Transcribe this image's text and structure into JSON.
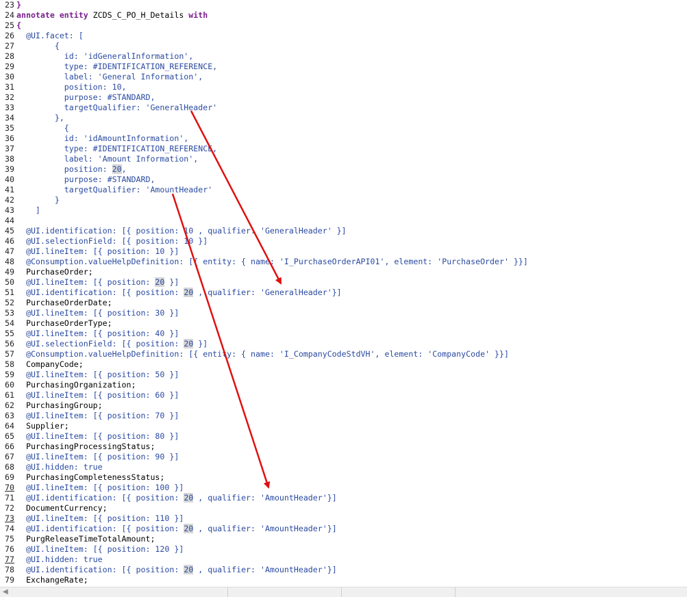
{
  "editor": {
    "lines": [
      {
        "n": "23",
        "t": "}"
      },
      {
        "n": "24",
        "t": "annotate entity ZCDS_C_PO_H_Details with"
      },
      {
        "n": "25",
        "t": "{"
      },
      {
        "n": "26",
        "t": "  @UI.facet: ["
      },
      {
        "n": "27",
        "t": "        {"
      },
      {
        "n": "28",
        "t": "          id: 'idGeneralInformation',"
      },
      {
        "n": "29",
        "t": "          type: #IDENTIFICATION_REFERENCE,"
      },
      {
        "n": "30",
        "t": "          label: 'General Information',"
      },
      {
        "n": "31",
        "t": "          position: 10,"
      },
      {
        "n": "32",
        "t": "          purpose: #STANDARD,"
      },
      {
        "n": "33",
        "t": "          targetQualifier: 'GeneralHeader'"
      },
      {
        "n": "34",
        "t": "        },"
      },
      {
        "n": "35",
        "t": "          {"
      },
      {
        "n": "36",
        "t": "          id: 'idAmountInformation',"
      },
      {
        "n": "37",
        "t": "          type: #IDENTIFICATION_REFERENCE,"
      },
      {
        "n": "38",
        "t": "          label: 'Amount Information',"
      },
      {
        "n": "39",
        "t": "          position: 20,"
      },
      {
        "n": "40",
        "t": "          purpose: #STANDARD,"
      },
      {
        "n": "41",
        "t": "          targetQualifier: 'AmountHeader'"
      },
      {
        "n": "42",
        "t": "        }"
      },
      {
        "n": "43",
        "t": "    ]"
      },
      {
        "n": "44",
        "t": ""
      },
      {
        "n": "45",
        "t": "  @UI.identification: [{ position: 10 , qualifier: 'GeneralHeader' }]"
      },
      {
        "n": "46",
        "t": "  @UI.selectionField: [{ position: 10 }]"
      },
      {
        "n": "47",
        "t": "  @UI.lineItem: [{ position: 10 }]"
      },
      {
        "n": "48",
        "t": "  @Consumption.valueHelpDefinition: [{ entity: { name: 'I_PurchaseOrderAPI01', element: 'PurchaseOrder' }}]"
      },
      {
        "n": "49",
        "t": "  PurchaseOrder;"
      },
      {
        "n": "50",
        "t": "  @UI.lineItem: [{ position: 20 }]"
      },
      {
        "n": "51",
        "t": "  @UI.identification: [{ position: 20 , qualifier: 'GeneralHeader'}]"
      },
      {
        "n": "52",
        "t": "  PurchaseOrderDate;"
      },
      {
        "n": "53",
        "t": "  @UI.lineItem: [{ position: 30 }]"
      },
      {
        "n": "54",
        "t": "  PurchaseOrderType;"
      },
      {
        "n": "55",
        "t": "  @UI.lineItem: [{ position: 40 }]"
      },
      {
        "n": "56",
        "t": "  @UI.selectionField: [{ position: 20 }]"
      },
      {
        "n": "57",
        "t": "  @Consumption.valueHelpDefinition: [{ entity: { name: 'I_CompanyCodeStdVH', element: 'CompanyCode' }}]"
      },
      {
        "n": "58",
        "t": "  CompanyCode;"
      },
      {
        "n": "59",
        "t": "  @UI.lineItem: [{ position: 50 }]"
      },
      {
        "n": "60",
        "t": "  PurchasingOrganization;"
      },
      {
        "n": "61",
        "t": "  @UI.lineItem: [{ position: 60 }]"
      },
      {
        "n": "62",
        "t": "  PurchasingGroup;"
      },
      {
        "n": "63",
        "t": "  @UI.lineItem: [{ position: 70 }]"
      },
      {
        "n": "64",
        "t": "  Supplier;"
      },
      {
        "n": "65",
        "t": "  @UI.lineItem: [{ position: 80 }]"
      },
      {
        "n": "66",
        "t": "  PurchasingProcessingStatus;"
      },
      {
        "n": "67",
        "t": "  @UI.lineItem: [{ position: 90 }]"
      },
      {
        "n": "68",
        "t": "  @UI.hidden: true"
      },
      {
        "n": "69",
        "t": "  PurchasingCompletenessStatus;"
      },
      {
        "n": "70",
        "t": "  @UI.lineItem: [{ position: 100 }]"
      },
      {
        "n": "71",
        "t": "  @UI.identification: [{ position: 20 , qualifier: 'AmountHeader'}]"
      },
      {
        "n": "72",
        "t": "  DocumentCurrency;"
      },
      {
        "n": "73",
        "t": "  @UI.lineItem: [{ position: 110 }]"
      },
      {
        "n": "74",
        "t": "  @UI.identification: [{ position: 20 , qualifier: 'AmountHeader'}]"
      },
      {
        "n": "75",
        "t": "  PurgReleaseTimeTotalAmount;"
      },
      {
        "n": "76",
        "t": "  @UI.lineItem: [{ position: 120 }]"
      },
      {
        "n": "77",
        "t": "  @UI.hidden: true"
      },
      {
        "n": "78",
        "t": "  @UI.identification: [{ position: 20 , qualifier: 'AmountHeader'}]"
      },
      {
        "n": "79",
        "t": "  ExchangeRate;"
      }
    ],
    "underlined_line_numbers": [
      "70",
      "73",
      "77"
    ],
    "highlighted_token": "20"
  },
  "colors": {
    "annotation": "#2a4aa0",
    "keyword": "#7b1f8f",
    "field": "#000000",
    "arrow": "#e01010",
    "highlight": "#d6d6d6"
  }
}
